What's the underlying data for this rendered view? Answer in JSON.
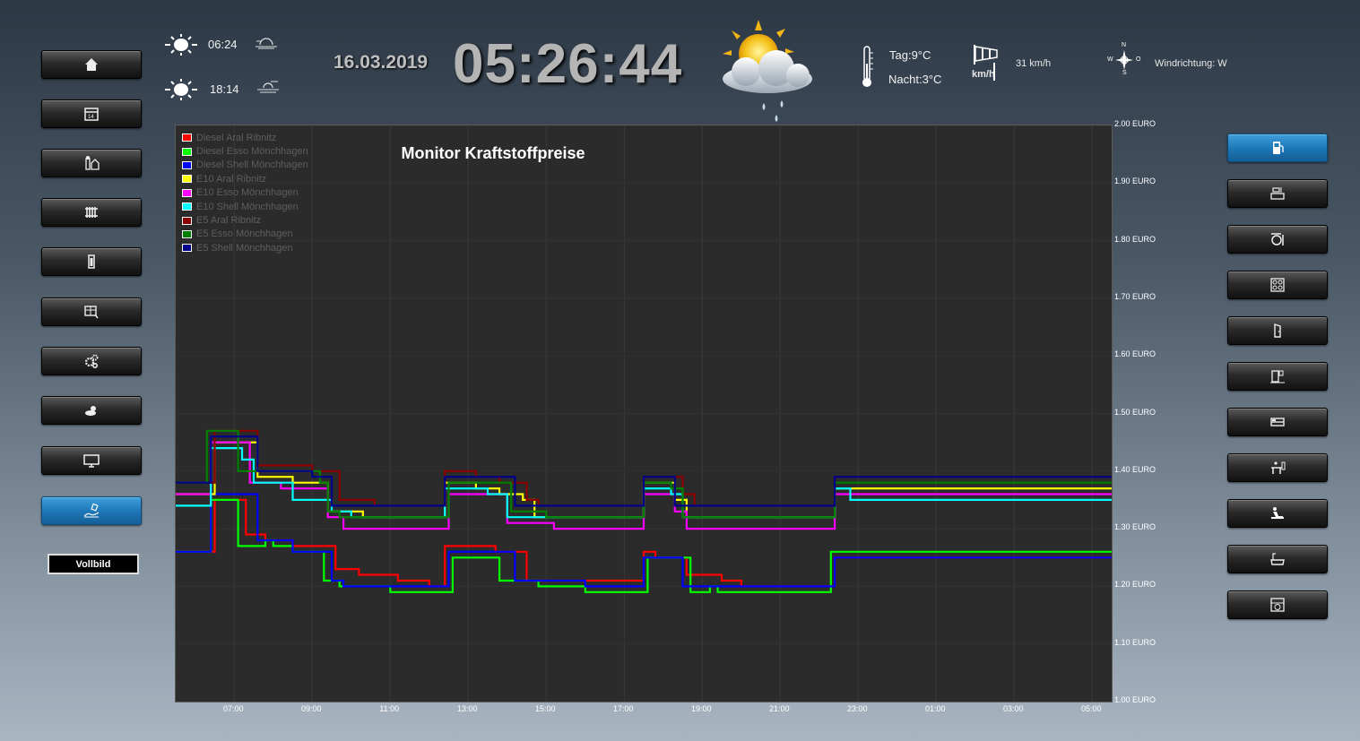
{
  "header": {
    "sunrise_time": "06:24",
    "sunset_time": "18:14",
    "date": "16.03.2019",
    "clock": "05:26:44",
    "temp_day": "Tag:9°C",
    "temp_night": "Nacht:3°C",
    "wind_unit": "km/h",
    "wind_speed": "31 km/h",
    "wind_direction": "Windrichtung: W",
    "compass": {
      "n": "N",
      "s": "S",
      "w": "W",
      "o": "O"
    }
  },
  "left_nav": {
    "items": [
      {
        "icon": "home-icon"
      },
      {
        "icon": "calendar-icon"
      },
      {
        "icon": "house-energy-icon"
      },
      {
        "icon": "radiator-icon"
      },
      {
        "icon": "battery-icon"
      },
      {
        "icon": "window-blind-icon"
      },
      {
        "icon": "settings-gears-icon"
      },
      {
        "icon": "weather-icon"
      },
      {
        "icon": "monitor-icon"
      },
      {
        "icon": "fuel-chart-icon",
        "active": true
      }
    ],
    "fullscreen_label": "Vollbild"
  },
  "right_nav": {
    "items": [
      {
        "icon": "fuel-pump-icon",
        "active": true
      },
      {
        "icon": "kitchen-icon"
      },
      {
        "icon": "dining-icon"
      },
      {
        "icon": "stove-icon"
      },
      {
        "icon": "door-icon"
      },
      {
        "icon": "hallway-icon"
      },
      {
        "icon": "bed-icon"
      },
      {
        "icon": "office-icon"
      },
      {
        "icon": "living-icon"
      },
      {
        "icon": "bath-icon"
      },
      {
        "icon": "utility-icon"
      }
    ]
  },
  "chart_data": {
    "type": "line",
    "title": "Monitor Kraftstoffpreise",
    "x_ticks": [
      "07:00",
      "09:00",
      "11:00",
      "13:00",
      "15:00",
      "17:00",
      "19:00",
      "21:00",
      "23:00",
      "01:00",
      "03:00",
      "05:00"
    ],
    "y_ticks": [
      "2.00 EURO",
      "1.90 EURO",
      "1.80 EURO",
      "1.70 EURO",
      "1.60 EURO",
      "1.50 EURO",
      "1.40 EURO",
      "1.30 EURO",
      "1.20 EURO",
      "1.10 EURO",
      "1.00 EURO"
    ],
    "ylim": [
      1.0,
      2.0
    ],
    "xlim_hours": [
      5.5,
      29.5
    ],
    "grid": true,
    "legend_position": "top-left",
    "series": [
      {
        "name": "Diesel Aral Ribnitz",
        "color": "#ff0000",
        "points": [
          [
            5.5,
            1.26
          ],
          [
            6.3,
            1.26
          ],
          [
            6.5,
            1.35
          ],
          [
            7.0,
            1.35
          ],
          [
            7.3,
            1.29
          ],
          [
            7.8,
            1.28
          ],
          [
            8.5,
            1.27
          ],
          [
            9.5,
            1.27
          ],
          [
            9.6,
            1.23
          ],
          [
            10.2,
            1.22
          ],
          [
            11.2,
            1.21
          ],
          [
            12.0,
            1.2
          ],
          [
            12.2,
            1.2
          ],
          [
            12.4,
            1.27
          ],
          [
            13.5,
            1.27
          ],
          [
            13.7,
            1.26
          ],
          [
            14.5,
            1.21
          ],
          [
            15.3,
            1.21
          ],
          [
            16.5,
            1.21
          ],
          [
            17.3,
            1.21
          ],
          [
            17.5,
            1.26
          ],
          [
            17.8,
            1.25
          ],
          [
            18.6,
            1.22
          ],
          [
            19.5,
            1.21
          ],
          [
            20.0,
            1.2
          ],
          [
            22.2,
            1.2
          ],
          [
            22.4,
            1.25
          ],
          [
            29.5,
            1.25
          ]
        ]
      },
      {
        "name": "Diesel Esso Mönchhagen",
        "color": "#00ff00",
        "points": [
          [
            5.5,
            1.26
          ],
          [
            6.2,
            1.26
          ],
          [
            6.4,
            1.35
          ],
          [
            6.9,
            1.35
          ],
          [
            7.1,
            1.27
          ],
          [
            7.5,
            1.27
          ],
          [
            7.8,
            1.28
          ],
          [
            8.0,
            1.27
          ],
          [
            8.5,
            1.26
          ],
          [
            9.2,
            1.26
          ],
          [
            9.3,
            1.21
          ],
          [
            9.7,
            1.2
          ],
          [
            10.5,
            1.2
          ],
          [
            11.0,
            1.19
          ],
          [
            12.0,
            1.19
          ],
          [
            12.4,
            1.19
          ],
          [
            12.6,
            1.25
          ],
          [
            13.6,
            1.25
          ],
          [
            13.8,
            1.21
          ],
          [
            14.4,
            1.21
          ],
          [
            14.8,
            1.2
          ],
          [
            16.0,
            1.19
          ],
          [
            17.4,
            1.19
          ],
          [
            17.6,
            1.25
          ],
          [
            18.5,
            1.25
          ],
          [
            18.7,
            1.19
          ],
          [
            19.0,
            1.19
          ],
          [
            19.2,
            1.2
          ],
          [
            19.4,
            1.19
          ],
          [
            22.2,
            1.19
          ],
          [
            22.3,
            1.26
          ],
          [
            29.5,
            1.26
          ]
        ]
      },
      {
        "name": "Diesel Shell Mönchhagen",
        "color": "#0000ff",
        "points": [
          [
            5.5,
            1.26
          ],
          [
            6.2,
            1.26
          ],
          [
            6.4,
            1.36
          ],
          [
            7.4,
            1.36
          ],
          [
            7.6,
            1.28
          ],
          [
            8.5,
            1.26
          ],
          [
            9.3,
            1.26
          ],
          [
            9.5,
            1.21
          ],
          [
            9.8,
            1.2
          ],
          [
            11.0,
            1.2
          ],
          [
            12.3,
            1.2
          ],
          [
            12.5,
            1.26
          ],
          [
            13.6,
            1.26
          ],
          [
            14.0,
            1.26
          ],
          [
            14.2,
            1.21
          ],
          [
            15.0,
            1.21
          ],
          [
            16.0,
            1.2
          ],
          [
            17.3,
            1.2
          ],
          [
            17.5,
            1.25
          ],
          [
            18.3,
            1.25
          ],
          [
            18.5,
            1.2
          ],
          [
            22.2,
            1.2
          ],
          [
            22.4,
            1.25
          ],
          [
            29.5,
            1.25
          ]
        ]
      },
      {
        "name": "E10 Aral Ribnitz",
        "color": "#ffff00",
        "points": [
          [
            5.5,
            1.36
          ],
          [
            6.3,
            1.36
          ],
          [
            6.5,
            1.45
          ],
          [
            7.4,
            1.45
          ],
          [
            7.6,
            1.39
          ],
          [
            8.3,
            1.39
          ],
          [
            8.5,
            1.38
          ],
          [
            9.2,
            1.38
          ],
          [
            9.4,
            1.33
          ],
          [
            10.2,
            1.33
          ],
          [
            10.3,
            1.32
          ],
          [
            12.2,
            1.32
          ],
          [
            12.4,
            1.38
          ],
          [
            13.2,
            1.37
          ],
          [
            13.8,
            1.36
          ],
          [
            14.4,
            1.35
          ],
          [
            14.7,
            1.32
          ],
          [
            17.3,
            1.32
          ],
          [
            17.5,
            1.38
          ],
          [
            18.3,
            1.35
          ],
          [
            18.6,
            1.32
          ],
          [
            22.2,
            1.32
          ],
          [
            22.4,
            1.37
          ],
          [
            29.5,
            1.37
          ]
        ]
      },
      {
        "name": "E10 Esso Mönchhagen",
        "color": "#ff00ff",
        "points": [
          [
            5.5,
            1.36
          ],
          [
            6.2,
            1.36
          ],
          [
            6.4,
            1.45
          ],
          [
            7.2,
            1.45
          ],
          [
            7.4,
            1.38
          ],
          [
            8.2,
            1.37
          ],
          [
            9.0,
            1.37
          ],
          [
            9.4,
            1.32
          ],
          [
            9.8,
            1.3
          ],
          [
            12.2,
            1.3
          ],
          [
            12.5,
            1.36
          ],
          [
            13.8,
            1.36
          ],
          [
            14.0,
            1.31
          ],
          [
            15.2,
            1.3
          ],
          [
            17.3,
            1.3
          ],
          [
            17.5,
            1.36
          ],
          [
            18.3,
            1.33
          ],
          [
            18.6,
            1.3
          ],
          [
            22.2,
            1.3
          ],
          [
            22.4,
            1.36
          ],
          [
            29.5,
            1.36
          ]
        ]
      },
      {
        "name": "E10 Shell Mönchhagen",
        "color": "#00ffff",
        "points": [
          [
            5.5,
            1.34
          ],
          [
            6.2,
            1.34
          ],
          [
            6.4,
            1.44
          ],
          [
            7.0,
            1.44
          ],
          [
            7.2,
            1.42
          ],
          [
            7.5,
            1.38
          ],
          [
            8.5,
            1.35
          ],
          [
            9.5,
            1.33
          ],
          [
            10.0,
            1.32
          ],
          [
            12.2,
            1.32
          ],
          [
            12.4,
            1.37
          ],
          [
            13.5,
            1.36
          ],
          [
            14.0,
            1.32
          ],
          [
            17.3,
            1.32
          ],
          [
            17.5,
            1.37
          ],
          [
            18.2,
            1.36
          ],
          [
            18.5,
            1.32
          ],
          [
            22.2,
            1.32
          ],
          [
            22.4,
            1.37
          ],
          [
            22.8,
            1.35
          ],
          [
            29.5,
            1.35
          ]
        ]
      },
      {
        "name": "E5 Aral Ribnitz",
        "color": "#8b0000",
        "points": [
          [
            5.5,
            1.38
          ],
          [
            6.3,
            1.38
          ],
          [
            6.5,
            1.47
          ],
          [
            7.5,
            1.47
          ],
          [
            7.6,
            1.41
          ],
          [
            8.5,
            1.41
          ],
          [
            9.0,
            1.4
          ],
          [
            9.5,
            1.4
          ],
          [
            9.7,
            1.35
          ],
          [
            10.5,
            1.35
          ],
          [
            10.6,
            1.34
          ],
          [
            12.2,
            1.34
          ],
          [
            12.4,
            1.4
          ],
          [
            13.2,
            1.39
          ],
          [
            13.8,
            1.38
          ],
          [
            14.5,
            1.35
          ],
          [
            14.8,
            1.34
          ],
          [
            17.3,
            1.34
          ],
          [
            17.5,
            1.39
          ],
          [
            18.5,
            1.36
          ],
          [
            18.8,
            1.34
          ],
          [
            22.2,
            1.34
          ],
          [
            22.4,
            1.39
          ],
          [
            29.5,
            1.39
          ]
        ]
      },
      {
        "name": "E5 Esso Mönchhagen",
        "color": "#008000",
        "points": [
          [
            5.5,
            1.38
          ],
          [
            6.1,
            1.38
          ],
          [
            6.3,
            1.47
          ],
          [
            6.9,
            1.47
          ],
          [
            7.1,
            1.4
          ],
          [
            8.0,
            1.4
          ],
          [
            9.2,
            1.38
          ],
          [
            9.4,
            1.33
          ],
          [
            9.7,
            1.32
          ],
          [
            12.2,
            1.32
          ],
          [
            12.5,
            1.38
          ],
          [
            13.8,
            1.38
          ],
          [
            14.1,
            1.33
          ],
          [
            15.0,
            1.32
          ],
          [
            17.3,
            1.32
          ],
          [
            17.5,
            1.38
          ],
          [
            18.2,
            1.37
          ],
          [
            18.5,
            1.32
          ],
          [
            22.2,
            1.32
          ],
          [
            22.4,
            1.38
          ],
          [
            29.5,
            1.38
          ]
        ]
      },
      {
        "name": "E5 Shell Mönchhagen",
        "color": "#00008b",
        "points": [
          [
            5.5,
            1.38
          ],
          [
            6.2,
            1.38
          ],
          [
            6.4,
            1.46
          ],
          [
            7.4,
            1.46
          ],
          [
            7.6,
            1.4
          ],
          [
            8.5,
            1.4
          ],
          [
            9.0,
            1.39
          ],
          [
            9.3,
            1.39
          ],
          [
            9.5,
            1.34
          ],
          [
            12.2,
            1.34
          ],
          [
            12.4,
            1.39
          ],
          [
            13.3,
            1.39
          ],
          [
            14.2,
            1.34
          ],
          [
            17.3,
            1.34
          ],
          [
            17.5,
            1.39
          ],
          [
            18.0,
            1.39
          ],
          [
            18.3,
            1.34
          ],
          [
            22.2,
            1.34
          ],
          [
            22.4,
            1.39
          ],
          [
            29.5,
            1.39
          ]
        ]
      }
    ]
  }
}
